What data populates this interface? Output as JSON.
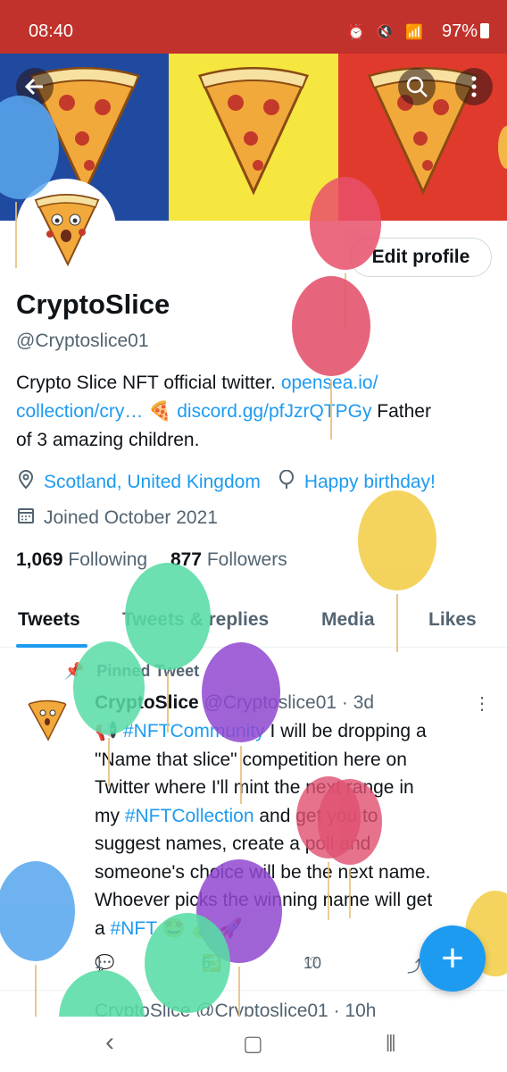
{
  "status_bar": {
    "time": "08:40",
    "battery": "97%"
  },
  "banner": {
    "colors": [
      "#1f4aa0",
      "#f5e640",
      "#e03a2c"
    ]
  },
  "profile": {
    "edit_label": "Edit profile",
    "name": "CryptoSlice",
    "handle": "@Cryptoslice01",
    "bio": {
      "line1_text": "Crypto Slice NFT official twitter. ",
      "line1_link": "opensea.io/",
      "line2_link": "collection/cry…",
      "line2_emoji": " 🍕 ",
      "line2_link2": "discord.gg/pfJzrQTPGy",
      "line2_text": " Father",
      "line3_text": "of 3 amazing children."
    },
    "location": "Scotland, United Kingdom",
    "birthday": "Happy birthday!",
    "joined": "Joined October 2021",
    "following_count": "1,069",
    "following_label": " Following",
    "followers_count": "877",
    "followers_label": " Followers"
  },
  "tabs": [
    "Tweets",
    "Tweets & replies",
    "Media",
    "Likes"
  ],
  "tweet": {
    "pinned_label": "Pinned Tweet",
    "author": "CryptoSlice",
    "handle_time": " @Cryptoslice01 · 3d",
    "lines": [
      {
        "pre": "📢 ",
        "link": "#NFTCommunity",
        "post": " I will be dropping a"
      },
      {
        "pre": "\"Name that slice\" competition here on",
        "link": "",
        "post": ""
      },
      {
        "pre": "Twitter where I'll mint the next range in",
        "link": "",
        "post": ""
      },
      {
        "pre": "my ",
        "link": "#NFTCollection",
        "post": " and get you to"
      },
      {
        "pre": "suggest names, create a poll and",
        "link": "",
        "post": ""
      },
      {
        "pre": "someone's choice will be the next name.",
        "link": "",
        "post": ""
      },
      {
        "pre": "Whoever picks the winning name will get",
        "link": "",
        "post": ""
      },
      {
        "pre": "a ",
        "link": "#NFT",
        "post": " 🤩 💰 🚀"
      }
    ],
    "replies": "1",
    "retweets": "6",
    "likes": "10"
  },
  "next_tweet_preview": "CryptoSlice @Cryptoslice01 · 10h",
  "fab_label": "+",
  "nav": {
    "back": "‹",
    "home": "▢",
    "recents": "|||"
  }
}
